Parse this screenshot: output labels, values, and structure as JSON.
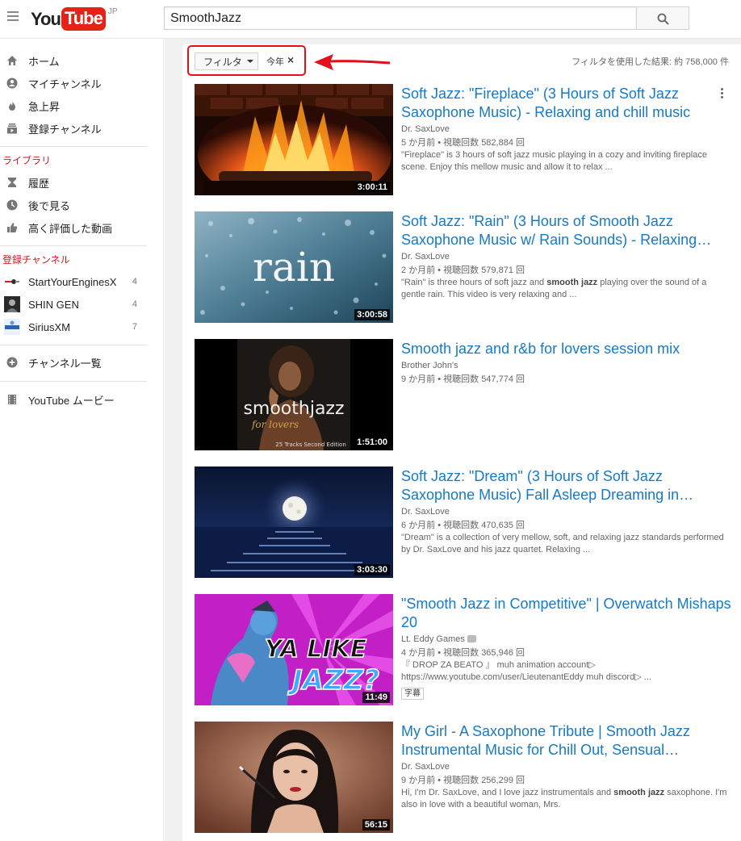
{
  "header": {
    "logo_you": "You",
    "logo_tube": "Tube",
    "logo_region": "JP",
    "search_value": "SmoothJazz"
  },
  "sidebar": {
    "main_items": [
      {
        "label": "ホーム",
        "icon": "home-icon"
      },
      {
        "label": "マイチャンネル",
        "icon": "account-icon"
      },
      {
        "label": "急上昇",
        "icon": "flame-icon"
      },
      {
        "label": "登録チャンネル",
        "icon": "subscriptions-icon"
      }
    ],
    "library_heading": "ライブラリ",
    "library_items": [
      {
        "label": "履歴",
        "icon": "hourglass-icon"
      },
      {
        "label": "後で見る",
        "icon": "clock-icon"
      },
      {
        "label": "高く評価した動画",
        "icon": "thumbs-up-icon"
      }
    ],
    "subs_heading": "登録チャンネル",
    "subscriptions": [
      {
        "label": "StartYourEnginesX",
        "count": "4"
      },
      {
        "label": "SHIN GEN",
        "count": "4"
      },
      {
        "label": "SiriusXM",
        "count": "7"
      }
    ],
    "browse_channels": "チャンネル一覧",
    "movies": "YouTube ムービー"
  },
  "filters": {
    "filter_label": "フィルタ",
    "active_chip": "今年",
    "chip_close": "×",
    "result_count": "フィルタを使用した結果: 約 758,000 件"
  },
  "results": [
    {
      "title": "Soft Jazz: \"Fireplace\" (3 Hours of Soft Jazz Saxophone Music) - Relaxing and chill music",
      "channel": "Dr. SaxLove",
      "meta": "5 か月前 • 視聴回数 582,884 回",
      "desc": "\"Fireplace\" is 3 hours of soft jazz music playing in a cozy and inviting fireplace scene. Enjoy this mellow music and allow it to relax ...",
      "duration": "3:00:11"
    },
    {
      "title": "Soft Jazz: \"Rain\" (3 Hours of Smooth Jazz Saxophone Music w/ Rain Sounds) - Relaxing and…",
      "channel": "Dr. SaxLove",
      "meta": "2 か月前 • 視聴回数 579,871 回",
      "desc_pre": "\"Rain\" is three hours of soft jazz and ",
      "desc_bold": "smooth jazz",
      "desc_post": " playing over the sound of a gentle rain. This video is very relaxing and ...",
      "duration": "3:00:58",
      "thumb_text": "rain"
    },
    {
      "title": "Smooth jazz and r&b for lovers session mix",
      "channel": "Brother John's",
      "meta": "9 か月前 • 視聴回数 547,774 回",
      "duration": "1:51:00",
      "thumb_title": "smoothjazz",
      "thumb_sub": "for lovers",
      "thumb_edition": "25 Tracks Second Edition"
    },
    {
      "title": "Soft Jazz: \"Dream\" (3 Hours of Soft Jazz Saxophone Music) Fall Asleep Dreaming in…",
      "channel": "Dr. SaxLove",
      "meta": "6 か月前 • 視聴回数 470,635 回",
      "desc": "\"Dream\" is a collection of very mellow, soft, and relaxing jazz standards performed by Dr. SaxLove and his jazz quartet. Relaxing ...",
      "duration": "3:03:30"
    },
    {
      "title": "\"Smooth Jazz in Competitive\" | Overwatch Mishaps 20",
      "channel": "Lt. Eddy Games",
      "meta": "4 か月前 • 視聴回数 365,946 回",
      "desc": "『 DROP ZA BEATO 』 muh animation account▷ https://www.youtube.com/user/LieutenantEddy muh discord▷ ...",
      "badge": "字幕",
      "duration": "11:49",
      "thumb_line1": "YA LIKE",
      "thumb_line2": "JAZZ?"
    },
    {
      "title": "My Girl - A Saxophone Tribute | Smooth Jazz Instrumental Music for Chill Out, Sensual…",
      "channel": "Dr. SaxLove",
      "meta": "9 か月前 • 視聴回数 256,299 回",
      "desc_pre": "Hi, I'm Dr. SaxLove, and I love jazz instrumentals and ",
      "desc_bold": "smooth jazz",
      "desc_post": " saxophone. I'm also in love with a beautiful woman, Mrs.",
      "duration": "56:15"
    }
  ],
  "colors": {
    "brand_red": "#e62117",
    "link_blue": "#167ac6",
    "annotation_red": "#e3101a"
  }
}
